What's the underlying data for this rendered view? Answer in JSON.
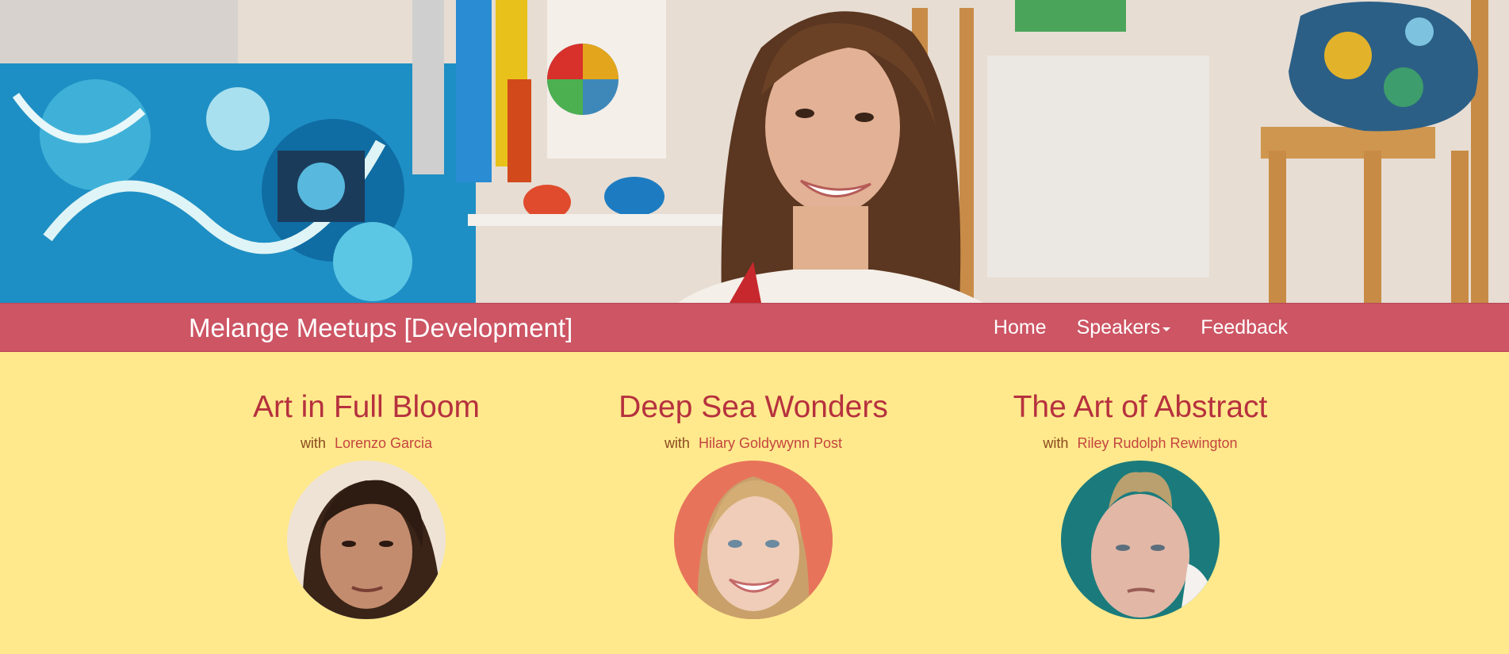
{
  "navbar": {
    "brand": "Melange Meetups [Development]",
    "items": [
      {
        "label": "Home"
      },
      {
        "label": "Speakers",
        "has_dropdown": true
      },
      {
        "label": "Feedback"
      }
    ]
  },
  "meetups": [
    {
      "title": "Art in Full Bloom",
      "with": "with",
      "speaker": "Lorenzo Garcia"
    },
    {
      "title": "Deep Sea Wonders",
      "with": "with",
      "speaker": "Hilary Goldywynn Post"
    },
    {
      "title": "The Art of Abstract",
      "with": "with",
      "speaker": "Riley Rudolph Rewington"
    }
  ],
  "colors": {
    "navbar": "#cd5564",
    "page_background": "#ffe98c",
    "title": "#b6313e",
    "speaker_link": "#c4453f"
  }
}
